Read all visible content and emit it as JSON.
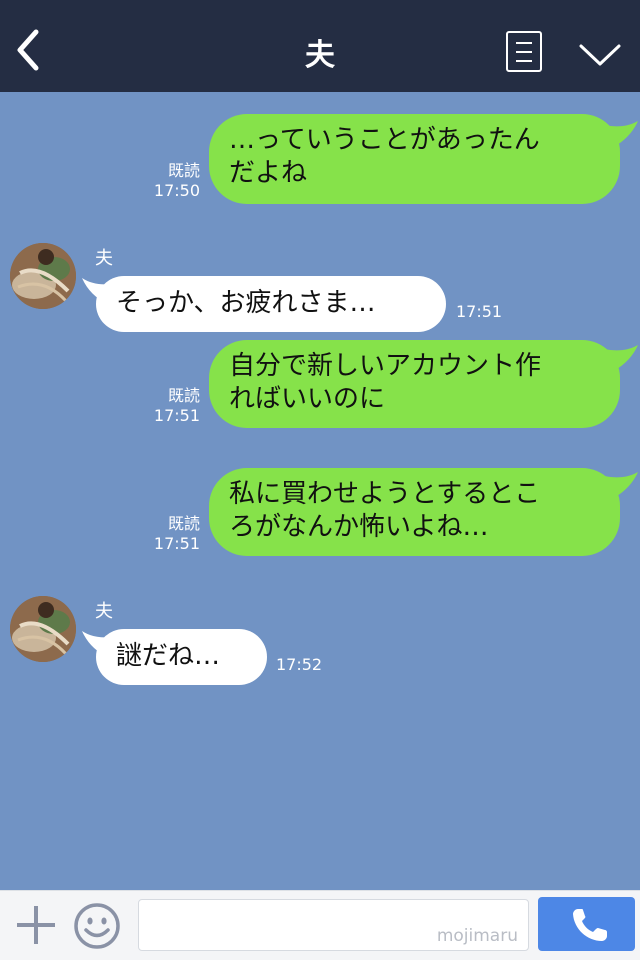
{
  "header": {
    "title": "夫"
  },
  "messages": [
    {
      "direction": "out",
      "lines": [
        "…っていうことがあったん",
        "だよね"
      ],
      "read_label": "既読",
      "time": "17:50"
    },
    {
      "direction": "in",
      "sender": "夫",
      "lines": [
        "そっか、お疲れさま…"
      ],
      "time": "17:51"
    },
    {
      "direction": "out",
      "lines": [
        "自分で新しいアカウント作",
        "ればいいのに"
      ],
      "read_label": "既読",
      "time": "17:51"
    },
    {
      "direction": "out",
      "lines": [
        "私に買わせようとするとこ",
        "ろがなんか怖いよね…"
      ],
      "read_label": "既読",
      "time": "17:51"
    },
    {
      "direction": "in",
      "sender": "夫",
      "lines": [
        "謎だね…"
      ],
      "time": "17:52"
    }
  ],
  "input": {
    "value": "",
    "watermark": "mojimaru"
  },
  "colors": {
    "header_bg": "#242d43",
    "chat_bg": "#7193c4",
    "outgoing_bubble": "#86e24a",
    "incoming_bubble": "#ffffff",
    "call_button": "#4d87e6"
  },
  "icons": {
    "back": "chevron-left-icon",
    "notes": "notes-icon",
    "menu": "chevron-down-icon",
    "plus": "plus-icon",
    "emoji": "smiley-icon",
    "call": "phone-icon"
  }
}
